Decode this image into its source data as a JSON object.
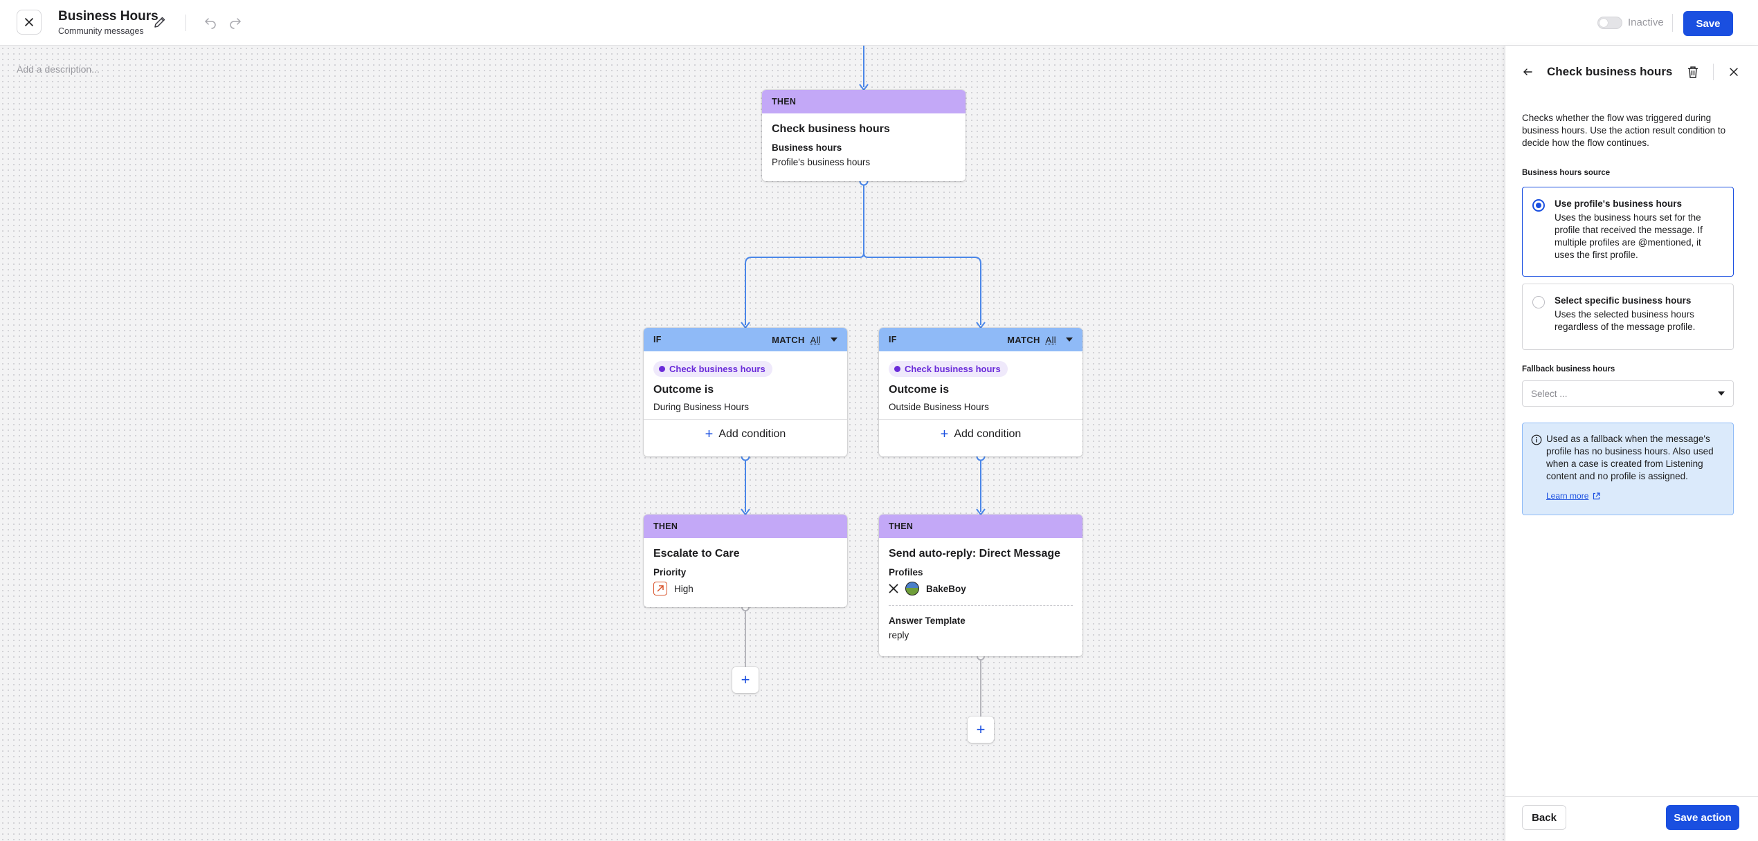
{
  "header": {
    "title": "Business Hours",
    "subtitle": "Community messages",
    "status_label": "Inactive",
    "save_label": "Save"
  },
  "canvas": {
    "description_placeholder": "Add a description..."
  },
  "nodes": {
    "check_hours": {
      "header": "THEN",
      "title": "Check business hours",
      "field_label": "Business hours",
      "field_value": "Profile's business hours"
    },
    "if_during": {
      "header": "IF",
      "match_label": "MATCH",
      "match_value": "All",
      "chip": "Check business hours",
      "title": "Outcome is",
      "value": "During Business Hours",
      "add_condition": "Add condition"
    },
    "if_outside": {
      "header": "IF",
      "match_label": "MATCH",
      "match_value": "All",
      "chip": "Check business hours",
      "title": "Outcome is",
      "value": "Outside Business Hours",
      "add_condition": "Add condition"
    },
    "escalate": {
      "header": "THEN",
      "title": "Escalate to Care",
      "field_label": "Priority",
      "field_value": "High"
    },
    "auto_reply": {
      "header": "THEN",
      "title": "Send auto-reply: Direct Message",
      "profiles_label": "Profiles",
      "profile_name": "BakeBoy",
      "template_label": "Answer Template",
      "template_value": "reply"
    }
  },
  "panel": {
    "title": "Check business hours",
    "description": "Checks whether the flow was triggered during business hours. Use the action result condition to decide how the flow continues.",
    "source_label": "Business hours source",
    "options": [
      {
        "title": "Use profile's business hours",
        "description": "Uses the business hours set for the profile that received the message. If multiple profiles are @mentioned, it uses the first profile.",
        "selected": true
      },
      {
        "title": "Select specific business hours",
        "description": "Uses the selected business hours regardless of the message profile.",
        "selected": false
      }
    ],
    "fallback_label": "Fallback business hours",
    "fallback_placeholder": "Select ...",
    "info_text": "Used as a fallback when the message's profile has no business hours. Also used when a case is created from Listening content and no profile is assigned.",
    "learn_more": "Learn more",
    "back_label": "Back",
    "save_action_label": "Save action"
  },
  "colors": {
    "accent": "#1a4fe0",
    "then_header": "#c3a8f7",
    "if_header": "#8fbaf7",
    "connector": "#4a86e8",
    "chip_text": "#6a2bd9",
    "priority_high": "#d9542b"
  },
  "icons": [
    "close-icon",
    "pencil-icon",
    "undo-icon",
    "redo-icon",
    "plus-icon",
    "x-logo-icon",
    "priority-high-icon",
    "arrow-left-icon",
    "trash-icon",
    "chevron-down-icon",
    "info-icon",
    "external-link-icon"
  ]
}
